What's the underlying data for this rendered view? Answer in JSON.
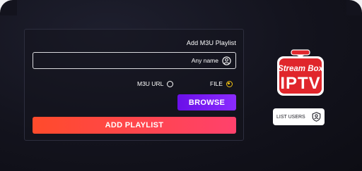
{
  "panel": {
    "title": "Add M3U Playlist",
    "name_field": {
      "value": "",
      "placeholder": "Any name",
      "icon": "user-circle-icon"
    },
    "source_options": [
      {
        "label": "M3U URL",
        "selected": false
      },
      {
        "label": "FILE",
        "selected": true
      }
    ],
    "browse_label": "BROWSE",
    "add_label": "ADD PLAYLIST"
  },
  "sidebar": {
    "logo": {
      "line1": "Stream Box",
      "line2": "IPTV"
    },
    "list_users_label": "LIST USERS",
    "list_users_icon": "user-shield-icon"
  },
  "colors": {
    "background": "#13131d",
    "browse_button": "#7a1ff4",
    "add_button": "#ff4747",
    "radio_selected": "#f3c211",
    "logo_red": "#e0262b"
  }
}
